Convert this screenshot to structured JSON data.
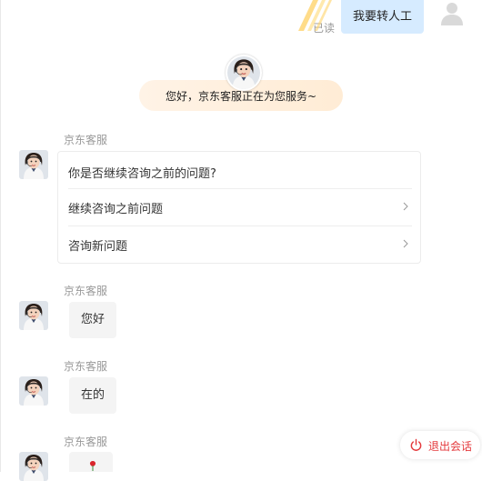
{
  "user_message": {
    "text": "我要转人工",
    "status": "已读"
  },
  "welcome": {
    "text": "您好，京东客服正在为您服务~"
  },
  "agent_name": "京东客服",
  "question_card": {
    "title": "你是否继续咨询之前的问题?",
    "options": [
      "继续咨询之前问题",
      "咨询新问题"
    ]
  },
  "messages": [
    "您好",
    "在的"
  ],
  "exit_button": {
    "label": "退出会话"
  },
  "colors": {
    "user_bubble": "#d6ebff",
    "exit_red": "#e4393c",
    "banner": "#fff3e6"
  }
}
